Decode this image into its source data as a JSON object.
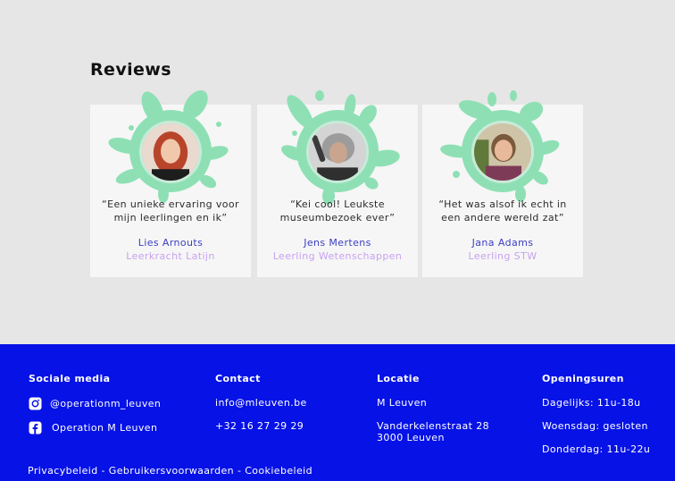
{
  "reviews": {
    "title": "Reviews",
    "items": [
      {
        "quote": "“Een unieke ervaring voor mijn leerlingen en ik”",
        "name": "Lies Arnouts",
        "role": "Leerkracht Latijn"
      },
      {
        "quote": "“Kei cool! Leukste museumbezoek ever”",
        "name": "Jens Mertens",
        "role": "Leerling Wetenschappen"
      },
      {
        "quote": "“Het was alsof ik echt in een andere wereld zat”",
        "name": "Jana Adams",
        "role": "Leerling STW"
      }
    ]
  },
  "footer": {
    "social": {
      "title": "Sociale media",
      "instagram": {
        "icon": "instagram-icon",
        "label": "@operationm_leuven"
      },
      "facebook": {
        "icon": "facebook-icon",
        "label": "Operation M Leuven"
      }
    },
    "contact": {
      "title": "Contact",
      "email": "info@mleuven.be",
      "phone": "+32 16 27 29 29"
    },
    "location": {
      "title": "Locatie",
      "name": "M Leuven",
      "street": "Vanderkelenstraat 28",
      "city": "3000 Leuven"
    },
    "hours": {
      "title": "Openingsuren",
      "daily": "Dagelijks: 11u-18u",
      "wednesday": "Woensdag: gesloten",
      "thursday": "Donderdag: 11u-22u"
    },
    "legal": "Privacybeleid - Gebruikersvoorwaarden - Cookiebeleid"
  },
  "colors": {
    "footer_bg": "#0612e6",
    "splash": "#8ee0b4",
    "name": "#3b3fc4",
    "role": "#c7a2f0"
  }
}
